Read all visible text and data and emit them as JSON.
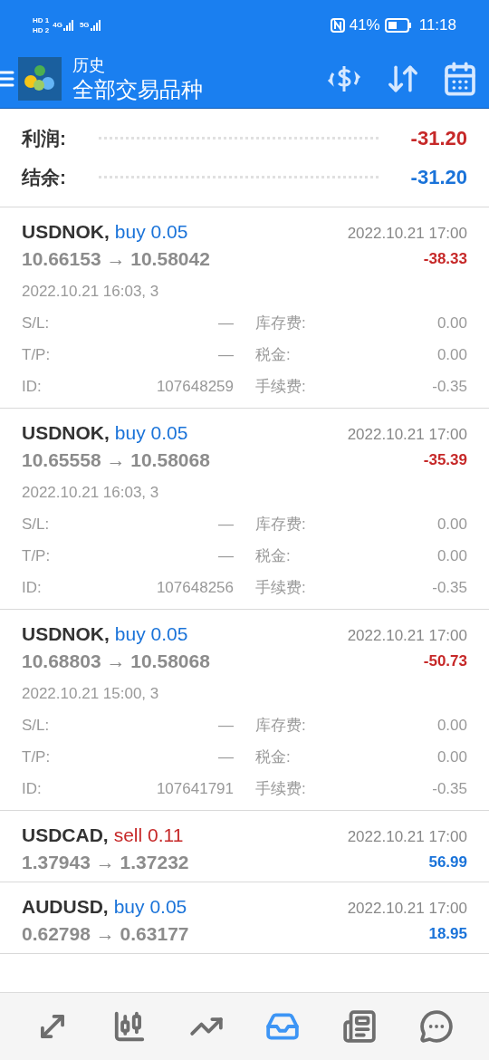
{
  "status_bar": {
    "sims": [
      "HD 1",
      "HD 2"
    ],
    "networks": [
      "4G",
      "5G"
    ],
    "battery": "41%",
    "time": "11:18"
  },
  "header": {
    "title": "历史",
    "subtitle": "全部交易品种"
  },
  "summary": [
    {
      "label": "利润:",
      "value": "-31.20",
      "kind": "loss"
    },
    {
      "label": "结余:",
      "value": "-31.20",
      "kind": "balance"
    }
  ],
  "trades": [
    {
      "symbol": "USDNOK,",
      "side": "buy",
      "volume": "0.05",
      "prices": "10.66153 → 10.58042",
      "close_time": "2022.10.21 17:00",
      "profit": "-38.33",
      "expanded": true,
      "open_time": "2022.10.21 16:03, 3",
      "details": [
        {
          "label": "S/L:",
          "value": "—"
        },
        {
          "label": "库存费:",
          "value": "0.00"
        },
        {
          "label": "T/P:",
          "value": "—"
        },
        {
          "label": "税金:",
          "value": "0.00"
        },
        {
          "label": "ID:",
          "value": "107648259"
        },
        {
          "label": "手续费:",
          "value": "-0.35"
        }
      ]
    },
    {
      "symbol": "USDNOK,",
      "side": "buy",
      "volume": "0.05",
      "prices": "10.65558 → 10.58068",
      "close_time": "2022.10.21 17:00",
      "profit": "-35.39",
      "expanded": true,
      "open_time": "2022.10.21 16:03, 3",
      "details": [
        {
          "label": "S/L:",
          "value": "—"
        },
        {
          "label": "库存费:",
          "value": "0.00"
        },
        {
          "label": "T/P:",
          "value": "—"
        },
        {
          "label": "税金:",
          "value": "0.00"
        },
        {
          "label": "ID:",
          "value": "107648256"
        },
        {
          "label": "手续费:",
          "value": "-0.35"
        }
      ]
    },
    {
      "symbol": "USDNOK,",
      "side": "buy",
      "volume": "0.05",
      "prices": "10.68803 → 10.58068",
      "close_time": "2022.10.21 17:00",
      "profit": "-50.73",
      "expanded": true,
      "open_time": "2022.10.21 15:00, 3",
      "details": [
        {
          "label": "S/L:",
          "value": "—"
        },
        {
          "label": "库存费:",
          "value": "0.00"
        },
        {
          "label": "T/P:",
          "value": "—"
        },
        {
          "label": "税金:",
          "value": "0.00"
        },
        {
          "label": "ID:",
          "value": "107641791"
        },
        {
          "label": "手续费:",
          "value": "-0.35"
        }
      ]
    },
    {
      "symbol": "USDCAD,",
      "side": "sell",
      "volume": "0.11",
      "prices": "1.37943 → 1.37232",
      "close_time": "2022.10.21 17:00",
      "profit": "56.99",
      "expanded": false
    },
    {
      "symbol": "AUDUSD,",
      "side": "buy",
      "volume": "0.05",
      "prices": "0.62798 → 0.63177",
      "close_time": "2022.10.21 17:00",
      "profit": "18.95",
      "expanded": false
    }
  ],
  "nav": [
    {
      "kind": "trade",
      "selected": false
    },
    {
      "kind": "quotes",
      "selected": false
    },
    {
      "kind": "chart",
      "selected": false
    },
    {
      "kind": "history",
      "selected": true
    },
    {
      "kind": "news",
      "selected": false
    },
    {
      "kind": "chat",
      "selected": false
    }
  ]
}
